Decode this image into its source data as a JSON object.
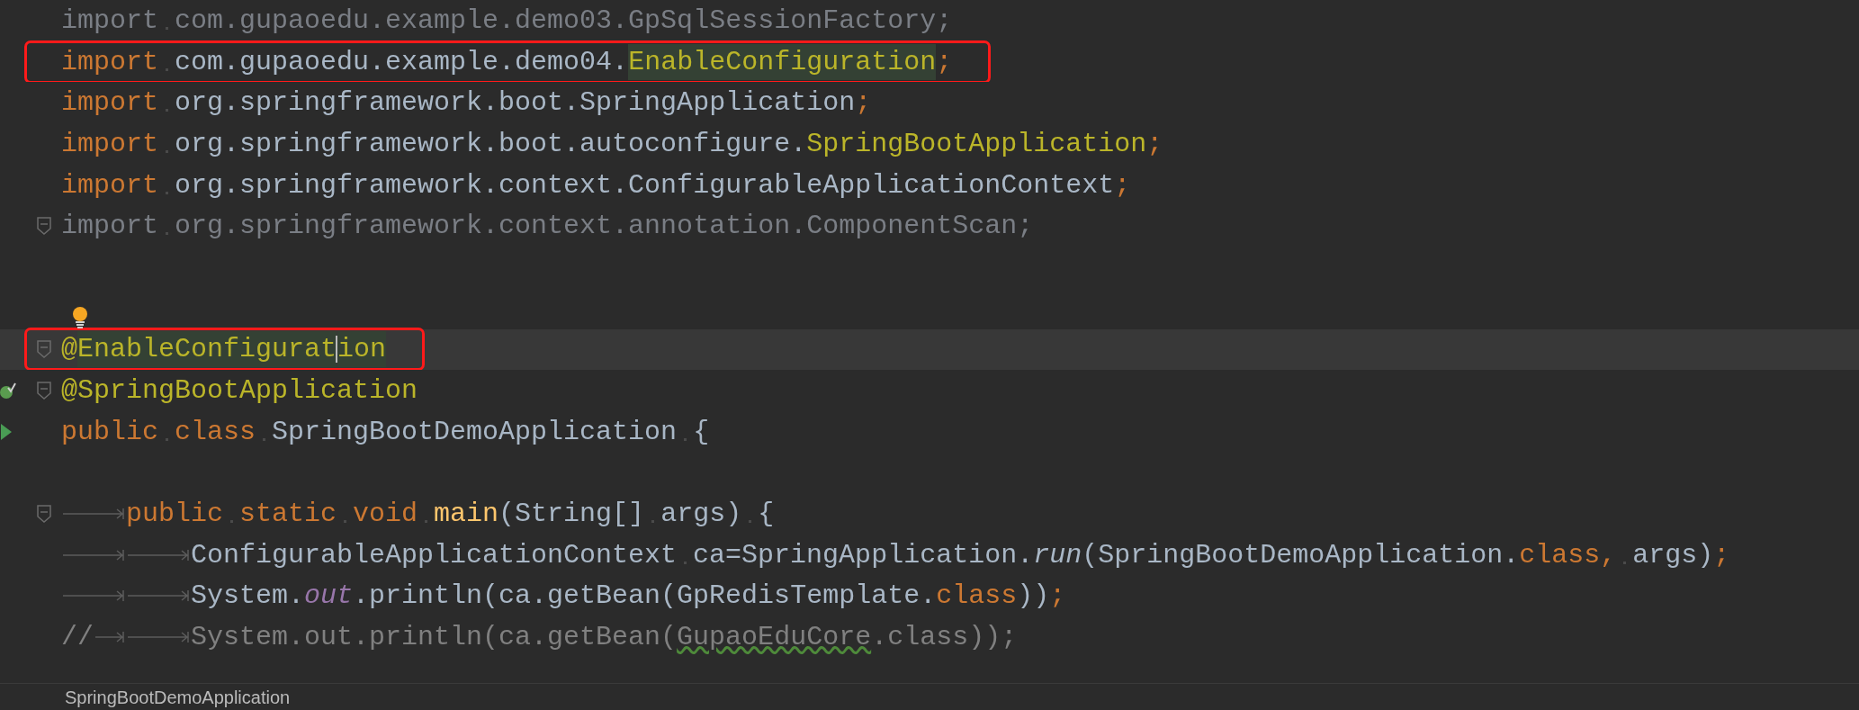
{
  "lines": [
    {
      "current": false,
      "boxed": false,
      "fold": false,
      "tokens": [
        {
          "kind": "dim",
          "text": "import"
        },
        {
          "kind": "ws"
        },
        {
          "kind": "dim",
          "text": "com.gupaoedu.example.demo03.GpSqlSessionFactory;"
        }
      ]
    },
    {
      "current": false,
      "boxed": true,
      "fold": false,
      "tokens": [
        {
          "kind": "kw",
          "text": "import"
        },
        {
          "kind": "ws"
        },
        {
          "kind": "plain",
          "text": "com.gupaoedu.example.demo04."
        },
        {
          "kind": "usage",
          "text": "EnableConfiguration"
        },
        {
          "kind": "kw",
          "text": ";"
        }
      ]
    },
    {
      "current": false,
      "boxed": false,
      "fold": false,
      "tokens": [
        {
          "kind": "kw",
          "text": "import"
        },
        {
          "kind": "ws"
        },
        {
          "kind": "plain",
          "text": "org.springframework.boot.SpringApplication"
        },
        {
          "kind": "kw",
          "text": ";"
        }
      ]
    },
    {
      "current": false,
      "boxed": false,
      "fold": false,
      "tokens": [
        {
          "kind": "kw",
          "text": "import"
        },
        {
          "kind": "ws"
        },
        {
          "kind": "plain",
          "text": "org.springframework.boot.autoconfigure."
        },
        {
          "kind": "annotation",
          "text": "SpringBootApplication"
        },
        {
          "kind": "kw",
          "text": ";"
        }
      ]
    },
    {
      "current": false,
      "boxed": false,
      "fold": false,
      "tokens": [
        {
          "kind": "kw",
          "text": "import"
        },
        {
          "kind": "ws"
        },
        {
          "kind": "plain",
          "text": "org.springframework.context.ConfigurableApplicationContext"
        },
        {
          "kind": "kw",
          "text": ";"
        }
      ]
    },
    {
      "current": false,
      "boxed": false,
      "fold": true,
      "tokens": [
        {
          "kind": "dim",
          "text": "import"
        },
        {
          "kind": "ws"
        },
        {
          "kind": "dim",
          "text": "org.springframework.context.annotation.ComponentScan;"
        }
      ]
    },
    {
      "current": false,
      "boxed": false,
      "fold": false
    },
    {
      "current": false,
      "boxed": false,
      "fold": false,
      "marker": {
        "kind": "bulb"
      }
    },
    {
      "current": true,
      "boxed": true,
      "fold": true,
      "tokens": [
        {
          "kind": "annotation",
          "text": "@"
        },
        {
          "kind": "usage",
          "text": "EnableConfigurat"
        },
        {
          "kind": "caret"
        },
        {
          "kind": "usage",
          "text": "ion"
        }
      ]
    },
    {
      "current": false,
      "boxed": false,
      "fold": true,
      "marker": {
        "kind": "bean"
      },
      "tokens": [
        {
          "kind": "annotation",
          "text": "@SpringBootApplication"
        }
      ]
    },
    {
      "current": false,
      "boxed": false,
      "fold": false,
      "marker": {
        "kind": "run"
      },
      "tokens": [
        {
          "kind": "kw",
          "text": "public"
        },
        {
          "kind": "ws"
        },
        {
          "kind": "kw",
          "text": "class"
        },
        {
          "kind": "ws"
        },
        {
          "kind": "plain",
          "text": "SpringBootDemoApplication"
        },
        {
          "kind": "ws"
        },
        {
          "kind": "plain",
          "text": "{"
        }
      ]
    },
    {
      "current": false,
      "boxed": false,
      "fold": false
    },
    {
      "current": false,
      "boxed": false,
      "fold": true,
      "tokens": [
        {
          "kind": "tab"
        },
        {
          "kind": "kw",
          "text": "public"
        },
        {
          "kind": "ws"
        },
        {
          "kind": "kw",
          "text": "static"
        },
        {
          "kind": "ws"
        },
        {
          "kind": "kw",
          "text": "void"
        },
        {
          "kind": "ws"
        },
        {
          "kind": "method",
          "text": "main"
        },
        {
          "kind": "plain",
          "text": "(String[]"
        },
        {
          "kind": "ws"
        },
        {
          "kind": "plain",
          "text": "args)"
        },
        {
          "kind": "ws"
        },
        {
          "kind": "plain",
          "text": "{"
        }
      ]
    },
    {
      "current": false,
      "boxed": false,
      "fold": false,
      "tokens": [
        {
          "kind": "tab"
        },
        {
          "kind": "tab"
        },
        {
          "kind": "plain",
          "text": "ConfigurableApplicationContext"
        },
        {
          "kind": "ws"
        },
        {
          "kind": "plain",
          "text": "ca=SpringApplication."
        },
        {
          "kind": "italic",
          "text": "run"
        },
        {
          "kind": "plain",
          "text": "(SpringBootDemoApplication."
        },
        {
          "kind": "kw",
          "text": "class,"
        },
        {
          "kind": "ws"
        },
        {
          "kind": "plain",
          "text": "args)"
        },
        {
          "kind": "kw",
          "text": ";"
        }
      ]
    },
    {
      "current": false,
      "boxed": false,
      "fold": false,
      "tokens": [
        {
          "kind": "tab"
        },
        {
          "kind": "tab"
        },
        {
          "kind": "plain",
          "text": "System."
        },
        {
          "kind": "static",
          "text": "out"
        },
        {
          "kind": "plain",
          "text": ".println(ca.getBean(GpRedisTemplate."
        },
        {
          "kind": "kw",
          "text": "class"
        },
        {
          "kind": "plain",
          "text": "))"
        },
        {
          "kind": "kw",
          "text": ";"
        }
      ]
    },
    {
      "current": false,
      "boxed": false,
      "fold": false,
      "tokens": [
        {
          "kind": "comment",
          "text": "//"
        },
        {
          "kind": "tab"
        },
        {
          "kind": "tab"
        },
        {
          "kind": "comment",
          "text": "System.out.println(ca.getBean("
        },
        {
          "kind": "typo",
          "text": "GupaoEduCore"
        },
        {
          "kind": "comment",
          "text": ".class));"
        }
      ]
    }
  ],
  "status_bar": {
    "breadcrumb": "SpringBootDemoApplication"
  }
}
